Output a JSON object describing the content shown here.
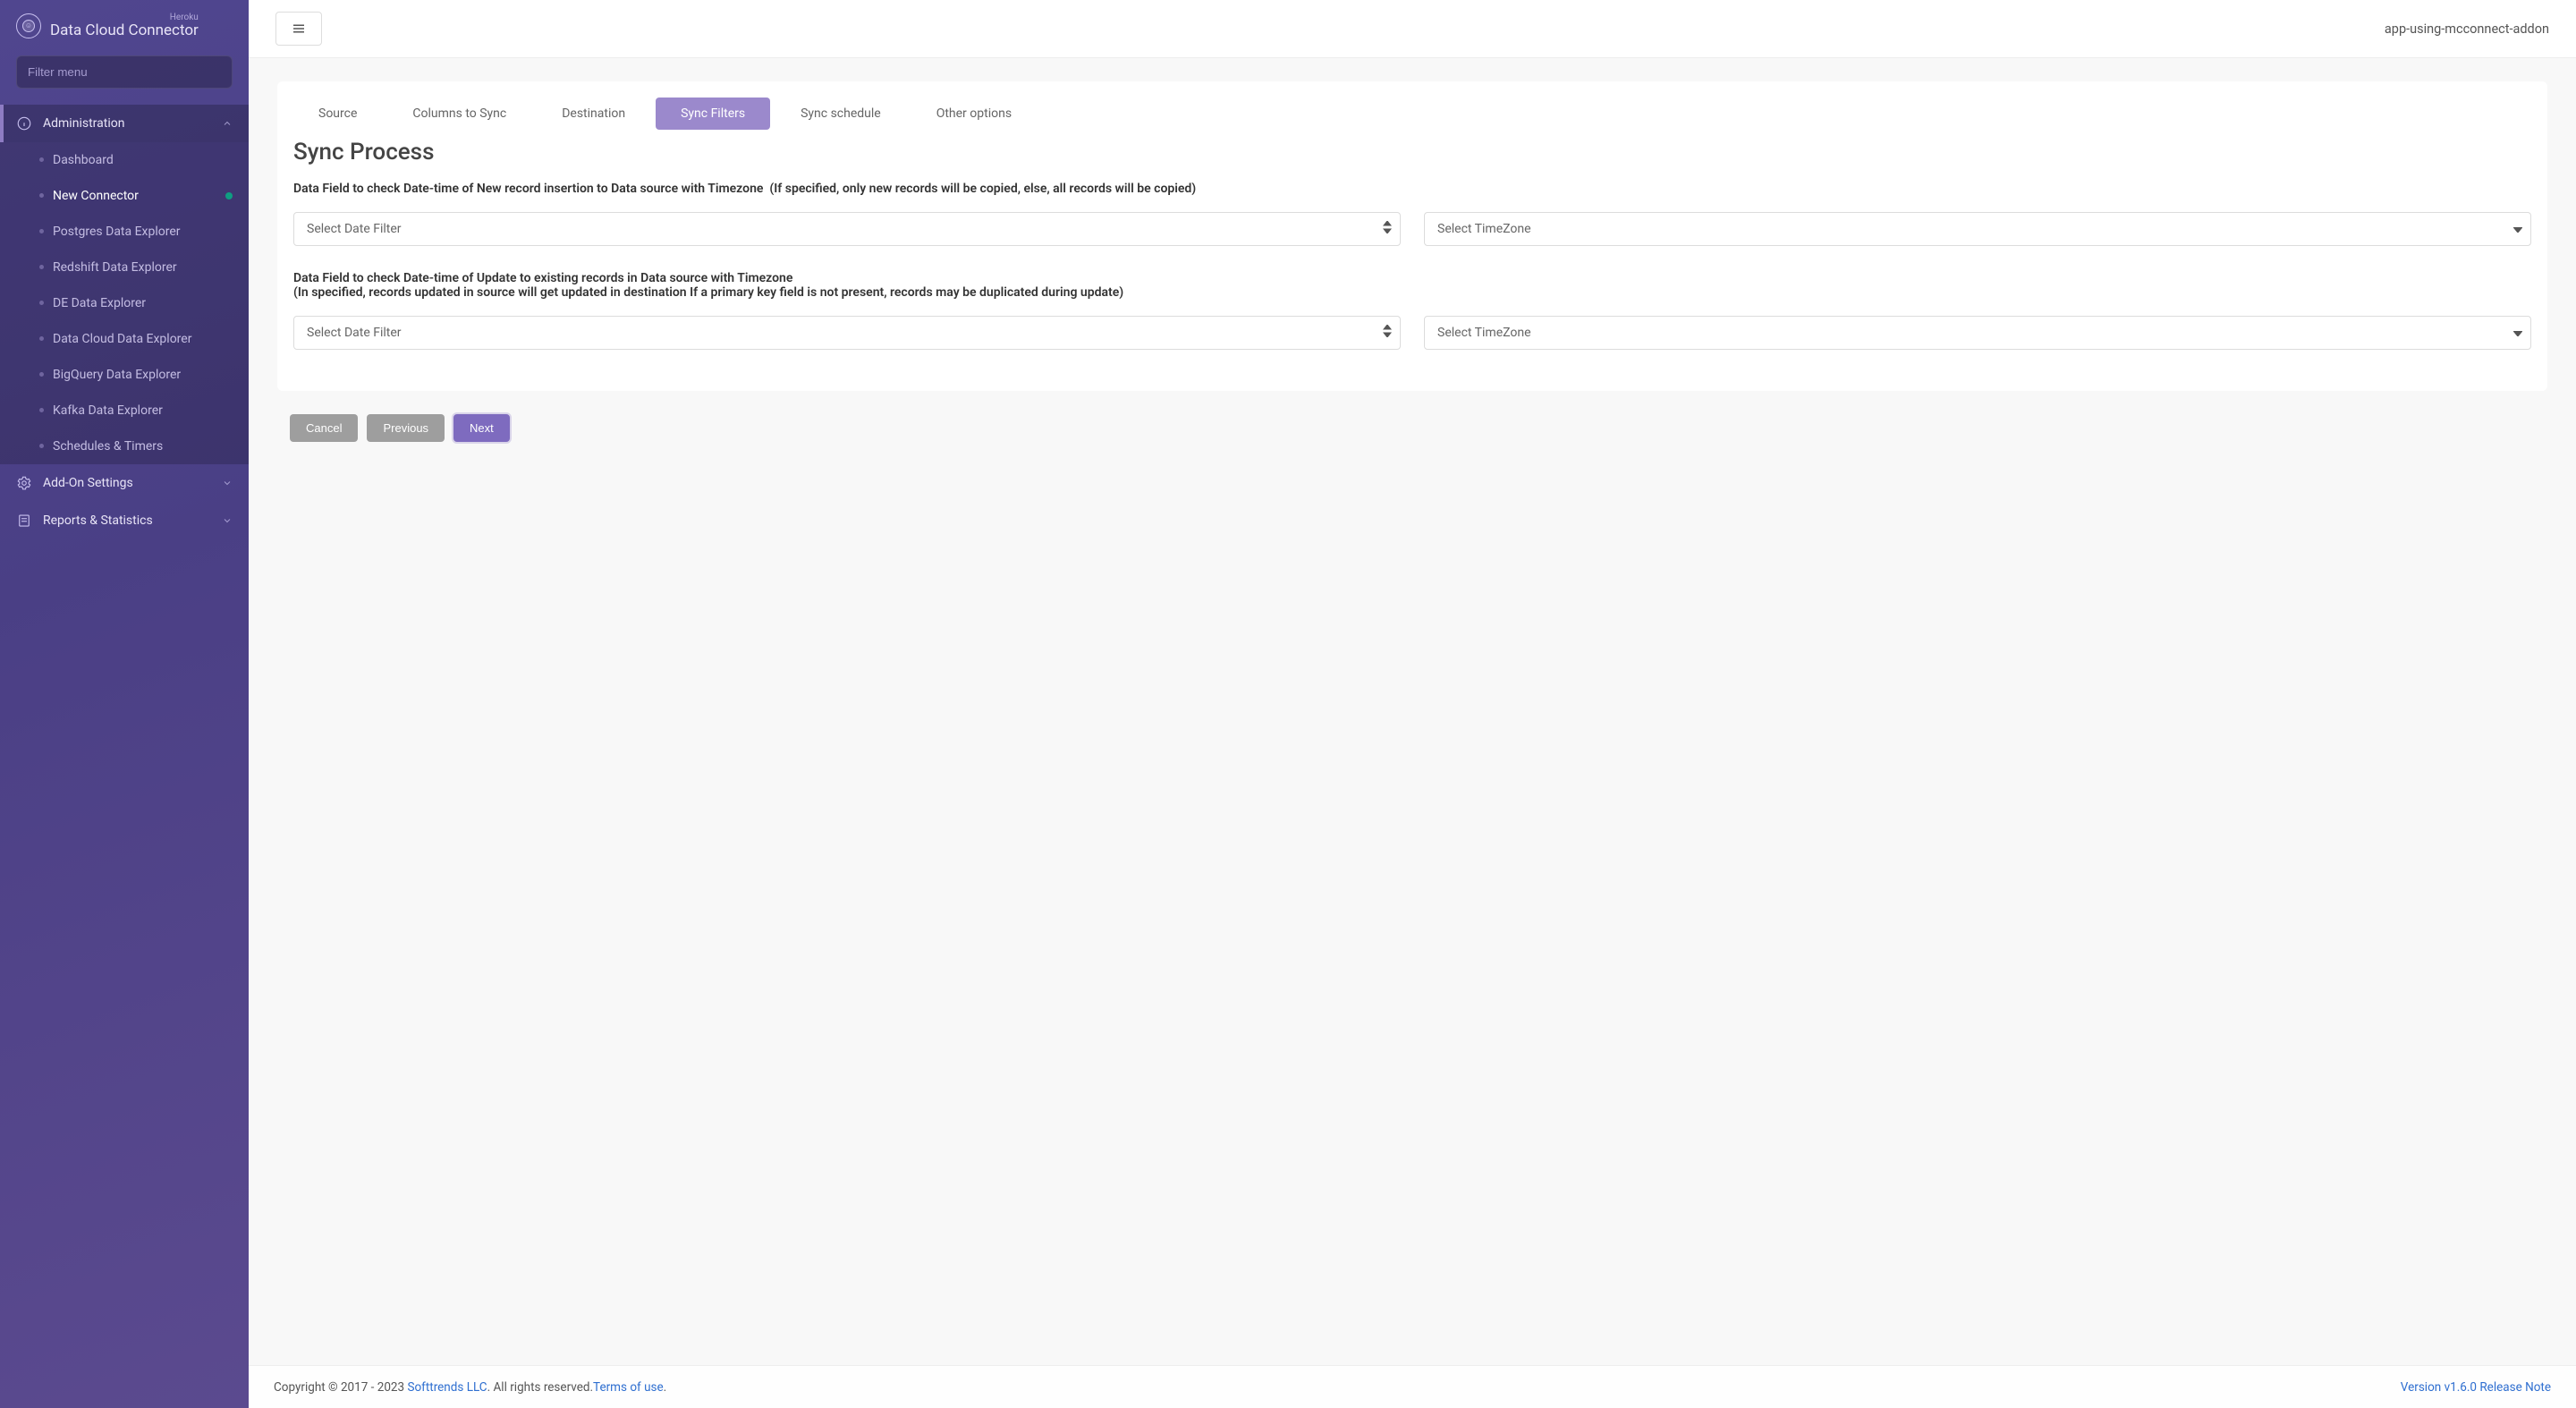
{
  "brand": {
    "sub": "Heroku",
    "title": "Data Cloud Connector"
  },
  "sidebar": {
    "filter_placeholder": "Filter menu",
    "groups": {
      "administration": {
        "label": "Administration"
      },
      "addon": {
        "label": "Add-On Settings"
      },
      "reports": {
        "label": "Reports & Statistics"
      }
    },
    "items": [
      {
        "label": "Dashboard"
      },
      {
        "label": "New Connector"
      },
      {
        "label": "Postgres Data Explorer"
      },
      {
        "label": "Redshift Data Explorer"
      },
      {
        "label": "DE Data Explorer"
      },
      {
        "label": "Data Cloud Data Explorer"
      },
      {
        "label": "BigQuery Data Explorer"
      },
      {
        "label": "Kafka Data Explorer"
      },
      {
        "label": "Schedules & Timers"
      }
    ]
  },
  "topbar": {
    "app_name": "app-using-mcconnect-addon"
  },
  "tabs": [
    {
      "label": "Source"
    },
    {
      "label": "Columns to Sync"
    },
    {
      "label": "Destination"
    },
    {
      "label": "Sync Filters"
    },
    {
      "label": "Sync schedule"
    },
    {
      "label": "Other options"
    }
  ],
  "page": {
    "title": "Sync Process",
    "section1_label": "Data Field to check Date-time of New record insertion to Data source with Timezone",
    "section1_hint": "(If specified, only new records will be copied, else, all records will be copied)",
    "section2_label": "Data Field to check Date-time of Update to existing records in Data source with Timezone",
    "section2_hint": "(In specified, records updated in source will get updated in destination If a primary key field is not present, records may be duplicated during update)",
    "select_date_filter": "Select Date Filter",
    "select_timezone": "Select TimeZone"
  },
  "buttons": {
    "cancel": "Cancel",
    "previous": "Previous",
    "next": "Next"
  },
  "footer": {
    "copyright_prefix": "Copyright © 2017 - 2023 ",
    "company": "Softtrends LLC",
    "rights": ". All rights reserved.",
    "terms": "Terms of use",
    "dot": ".",
    "version": "Version v1.6.0 ",
    "release": " Release Note"
  }
}
